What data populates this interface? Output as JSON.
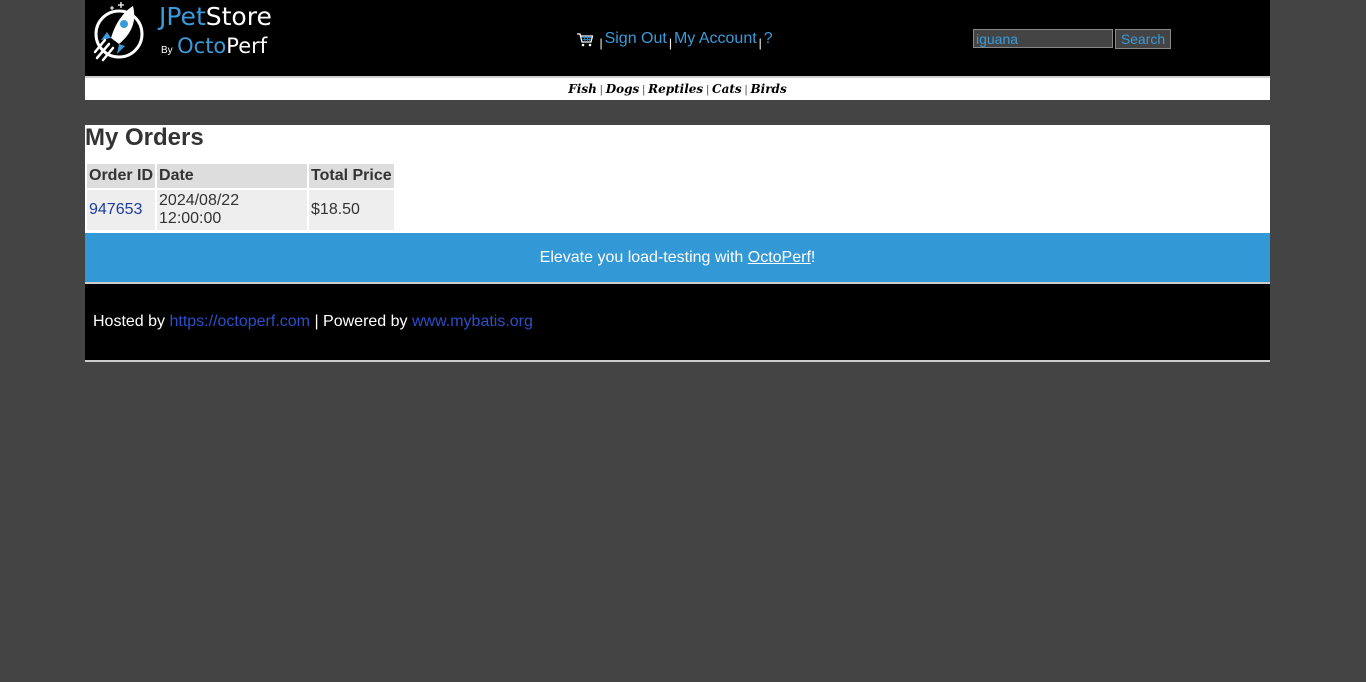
{
  "header": {
    "logo": {
      "jpet": "JPet",
      "store": "Store",
      "by": "By",
      "octo": "Octo",
      "perf": "Perf"
    },
    "menu": {
      "cart_icon": "cart-icon",
      "sign_out": "Sign Out",
      "my_account": "My Account",
      "help": "?"
    },
    "search": {
      "value": "iguana",
      "button": "Search"
    }
  },
  "quicklinks": [
    "Fish",
    "Dogs",
    "Reptiles",
    "Cats",
    "Birds"
  ],
  "main": {
    "title": "My Orders",
    "table": {
      "headers": [
        "Order ID",
        "Date",
        "Total Price"
      ],
      "rows": [
        {
          "order_id": "947653",
          "date": "2024/08/22 12:00:00",
          "total": "$18.50"
        }
      ]
    }
  },
  "promo": {
    "text": "Elevate you load-testing with ",
    "link": "OctoPerf",
    "suffix": "!"
  },
  "footer": {
    "hosted_by": "Hosted by ",
    "hosted_link": "https://octoperf.com",
    "powered_by": " | Powered by ",
    "powered_link": "www.mybatis.org"
  },
  "colors": {
    "accent": "#3a9ad9",
    "promo_bg": "#3398d6",
    "page_bg": "#444444"
  }
}
